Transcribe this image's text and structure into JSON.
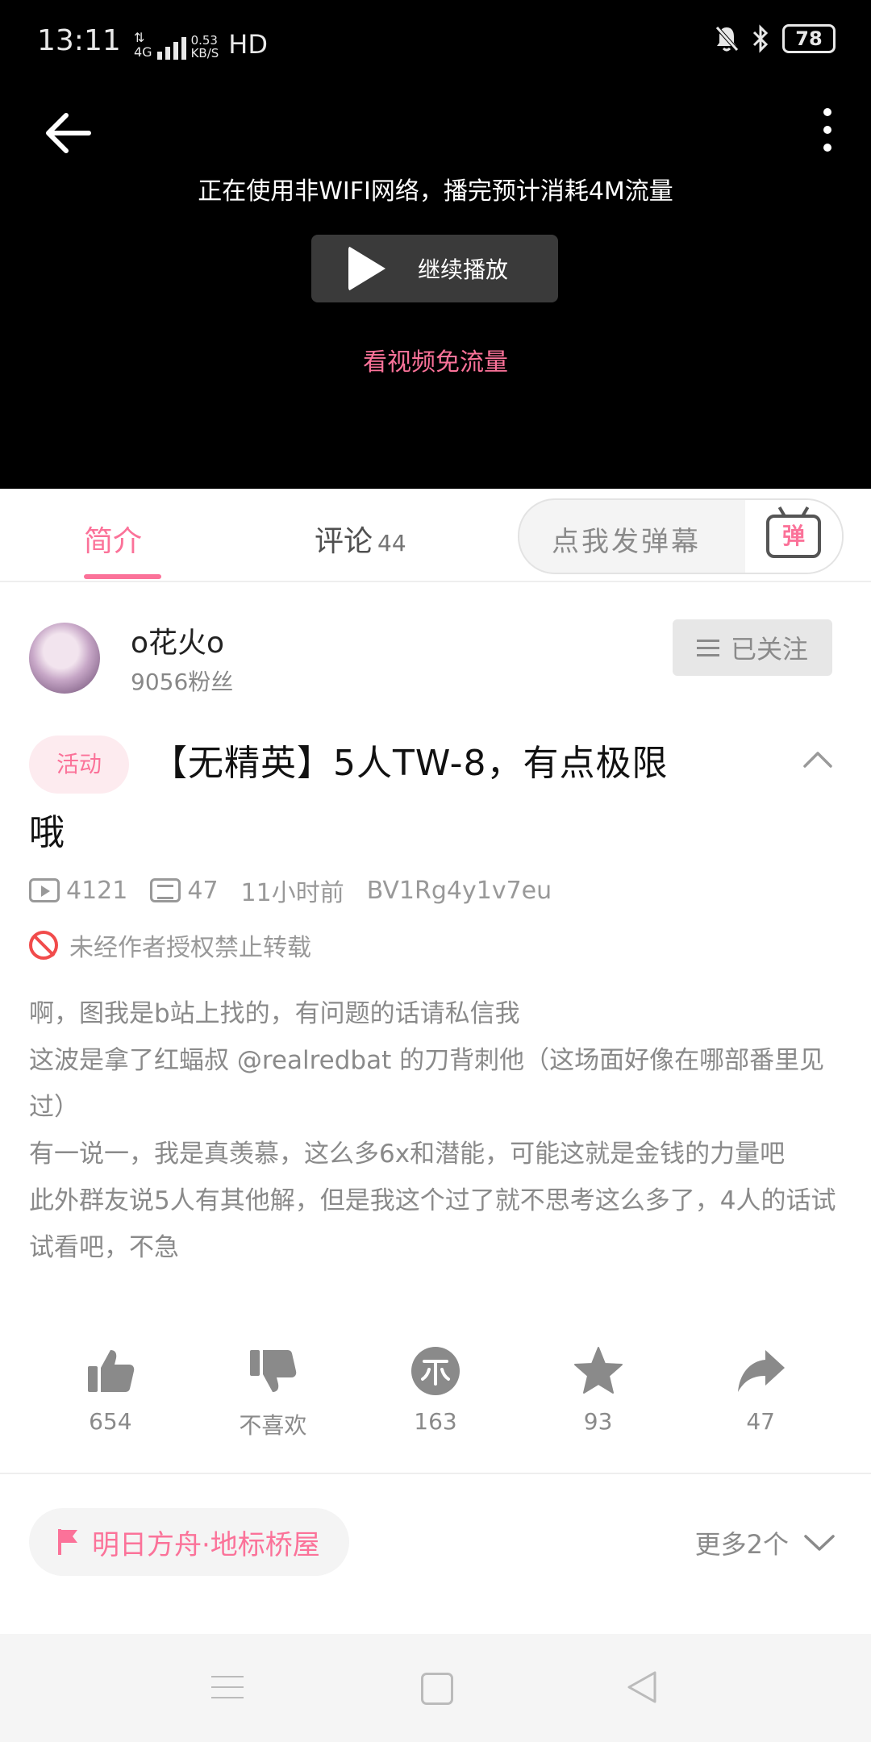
{
  "status_bar": {
    "time": "13:11",
    "network": "4G",
    "speed_value": "0.53",
    "speed_unit": "KB/S",
    "hd": "HD",
    "battery": "78"
  },
  "player": {
    "notice": "正在使用非WIFI网络，播完预计消耗4M流量",
    "continue_label": "继续播放",
    "free_data_link": "看视频免流量"
  },
  "tabs": {
    "intro": "简介",
    "comments": "评论",
    "comments_count": "44",
    "danmaku_placeholder": "点我发弹幕",
    "danmaku_icon_char": "弹"
  },
  "uploader": {
    "name": "o花火o",
    "fans": "9056粉丝",
    "follow_label": "已关注"
  },
  "video": {
    "tag": "活动",
    "title_line1": "【无精英】5人TW-8，有点极限",
    "title_line2": "哦",
    "views": "4121",
    "danmaku_count": "47",
    "time_ago": "11小时前",
    "bvid": "BV1Rg4y1v7eu",
    "copyright": "未经作者授权禁止转载"
  },
  "description": [
    "啊，图我是b站上找的，有问题的话请私信我",
    "这波是拿了红蝠叔 @realredbat  的刀背刺他（这场面好像在哪部番里见过）",
    "有一说一，我是真羡慕，这么多6x和潜能，可能这就是金钱的力量吧",
    "此外群友说5人有其他解，但是我这个过了就不思考这么多了，4人的话试试看吧，不急"
  ],
  "actions": {
    "like": "654",
    "dislike": "不喜欢",
    "coin": "163",
    "favorite": "93",
    "share": "47"
  },
  "topic": {
    "label": "明日方舟·地标桥屋",
    "more": "更多2个"
  },
  "colors": {
    "accent": "#fb7299",
    "player_bg": "#000000",
    "icon_gray": "#8a8a8a"
  }
}
